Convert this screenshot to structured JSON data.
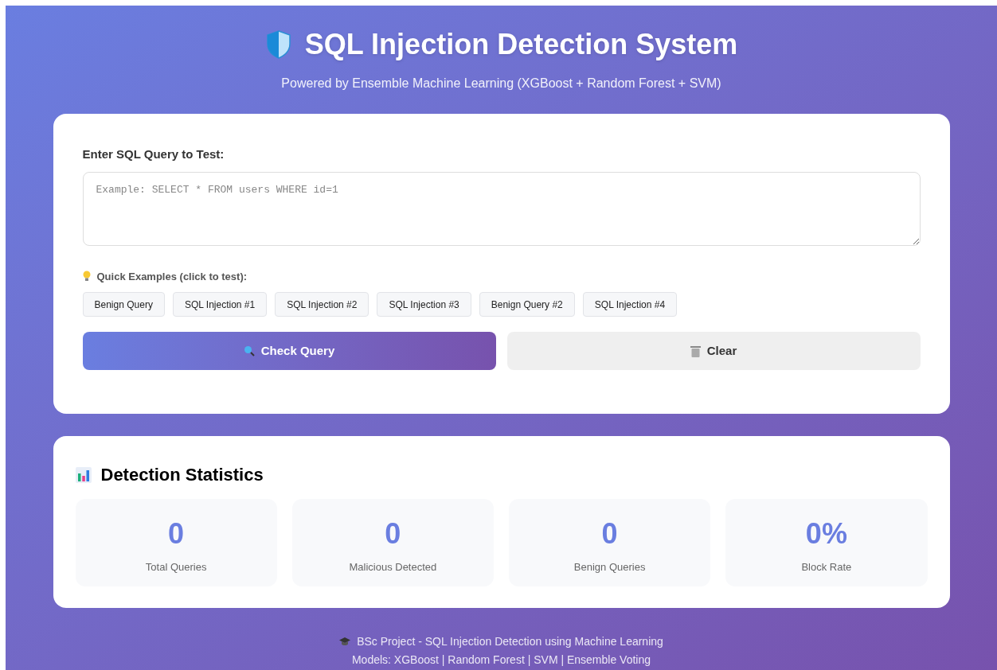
{
  "header": {
    "title": "SQL Injection Detection System",
    "subtitle": "Powered by Ensemble Machine Learning (XGBoost + Random Forest + SVM)"
  },
  "query_card": {
    "label": "Enter SQL Query to Test:",
    "placeholder": "Example: SELECT * FROM users WHERE id=1",
    "examples_label": "Quick Examples (click to test):",
    "examples": [
      "Benign Query",
      "SQL Injection #1",
      "SQL Injection #2",
      "SQL Injection #3",
      "Benign Query #2",
      "SQL Injection #4"
    ],
    "buttons": [
      {
        "kind": "check",
        "label": "Check Query"
      },
      {
        "kind": "clear",
        "label": "Clear"
      }
    ]
  },
  "statistics": {
    "title": "Detection Statistics",
    "stats": [
      {
        "value": "0",
        "label": "Total Queries"
      },
      {
        "value": "0",
        "label": "Malicious Detected"
      },
      {
        "value": "0",
        "label": "Benign Queries"
      },
      {
        "value": "0%",
        "label": "Block Rate"
      }
    ]
  },
  "footer": [
    "BSc Project - SQL Injection Detection using Machine Learning",
    "Models: XGBoost | Random Forest | SVM | Ensemble Voting"
  ]
}
